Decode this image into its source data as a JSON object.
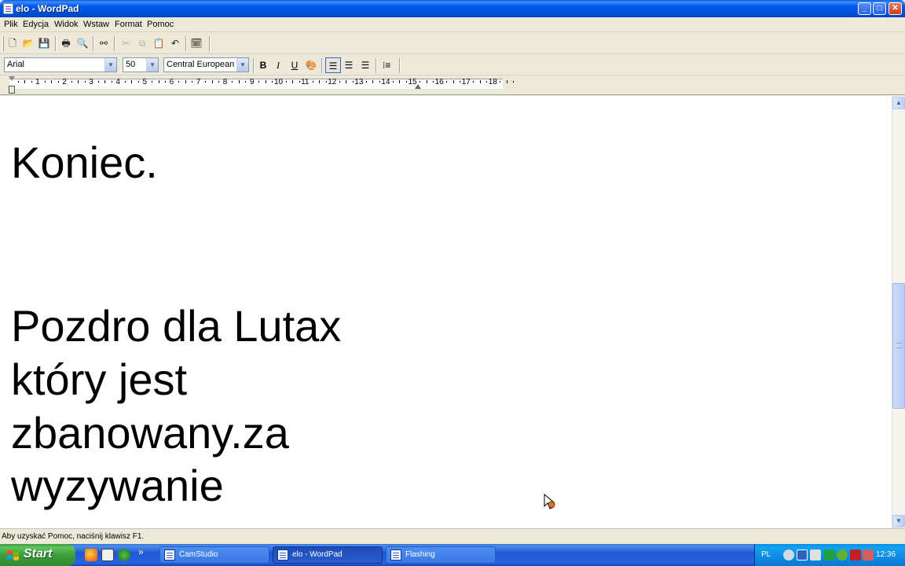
{
  "window": {
    "title": "elo - WordPad",
    "controls": {
      "minimize": "_",
      "maximize": "□",
      "close": "✕"
    }
  },
  "menu": [
    "Plik",
    "Edycja",
    "Widok",
    "Wstaw",
    "Format",
    "Pomoc"
  ],
  "format_bar": {
    "font": "Arial",
    "size": "50",
    "script": "Central European",
    "bold": "B",
    "italic": "I",
    "underline": "U"
  },
  "ruler": {
    "numbers": [
      "1",
      "2",
      "3",
      "4",
      "5",
      "6",
      "7",
      "8",
      "9",
      "10",
      "11",
      "12",
      "13",
      "14",
      "15",
      "16",
      "17",
      "18"
    ]
  },
  "document": {
    "lines": [
      "Koniec.",
      "",
      "",
      "Pozdro dla Lutax",
      "który jest",
      "zbanowany.za",
      "wyzywanie"
    ]
  },
  "status_bar": {
    "text": "Aby uzyskać Pomoc, naciśnij klawisz F1."
  },
  "taskbar": {
    "start_label": "Start",
    "quicklaunch_more": "»",
    "tasks": [
      {
        "label": "CamStudio",
        "active": false
      },
      {
        "label": "elo - WordPad",
        "active": true
      },
      {
        "label": "Flashing",
        "active": false
      }
    ],
    "tray": {
      "language": "PL",
      "clock": "12:36"
    }
  },
  "colors": {
    "titlebar": "#0058ee",
    "taskbar": "#2157d7",
    "start": "#3a9e3a",
    "tray": "#0d8ae3",
    "chrome": "#ece9d8"
  }
}
